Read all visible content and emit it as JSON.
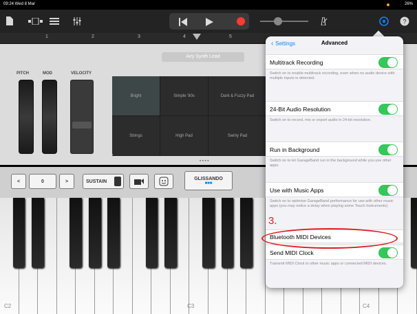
{
  "status": {
    "time_date": "09:24  Wed 8 Mar",
    "battery": "26%"
  },
  "toolbar": {
    "icons": [
      "document-icon",
      "view-toggle-icon",
      "tracks-icon",
      "mixer-icon",
      "rewind-icon",
      "play-icon",
      "record-icon",
      "volume-slider",
      "metronome-icon",
      "settings-icon",
      "help-icon"
    ]
  },
  "ruler": {
    "marks": [
      "1",
      "2",
      "3",
      "4",
      "5"
    ]
  },
  "instrument": {
    "preset_name": "Airy Synth Lead",
    "labels": {
      "pitch": "PITCH",
      "mod": "MOD",
      "velocity": "VELOCITY"
    },
    "patch_grid": [
      [
        "Bright",
        "Simple '80s",
        "Dark & Fuzzy Pad"
      ],
      [
        "Strings",
        "High Pad",
        "Swirly Pad"
      ]
    ],
    "page_dots": "• • • •"
  },
  "controls": {
    "octave_down": "<",
    "octave_value": "0",
    "octave_up": ">",
    "sustain": "SUSTAIN",
    "glissando": "GLISSANDO"
  },
  "keyboard": {
    "labels": [
      "C2",
      "C3",
      "C4"
    ]
  },
  "settings": {
    "back_label": "Settings",
    "title": "Advanced",
    "rows": [
      {
        "label": "Multitrack Recording",
        "toggle": true,
        "desc": "Switch on to enable multitrack recording, even when no audio device with multiple inputs is detected."
      },
      {
        "label": "24-Bit Audio Resolution",
        "toggle": true,
        "desc": "Switch on to record, mix or export audio in 24-bit resolution."
      },
      {
        "label": "Run in Background",
        "toggle": true,
        "desc": "Switch on to let GarageBand run in the background while you use other apps."
      },
      {
        "label": "Use with Music Apps",
        "toggle": true,
        "desc": "Switch on to optimise GarageBand performance for use with other music apps (you may notice a delay when playing some Touch Instruments)."
      },
      {
        "label": "Bluetooth MIDI Devices",
        "toggle": false,
        "desc": ""
      },
      {
        "label": "Send MIDI Clock",
        "toggle": true,
        "desc": "Transmit MIDI Clock to other music apps or connected MIDI devices."
      }
    ]
  },
  "annotation": {
    "number": "3.",
    "color": "#e02020"
  },
  "colors": {
    "accent": "#0a84ff",
    "toggle_on": "#34c759",
    "record": "#ff3b30"
  }
}
